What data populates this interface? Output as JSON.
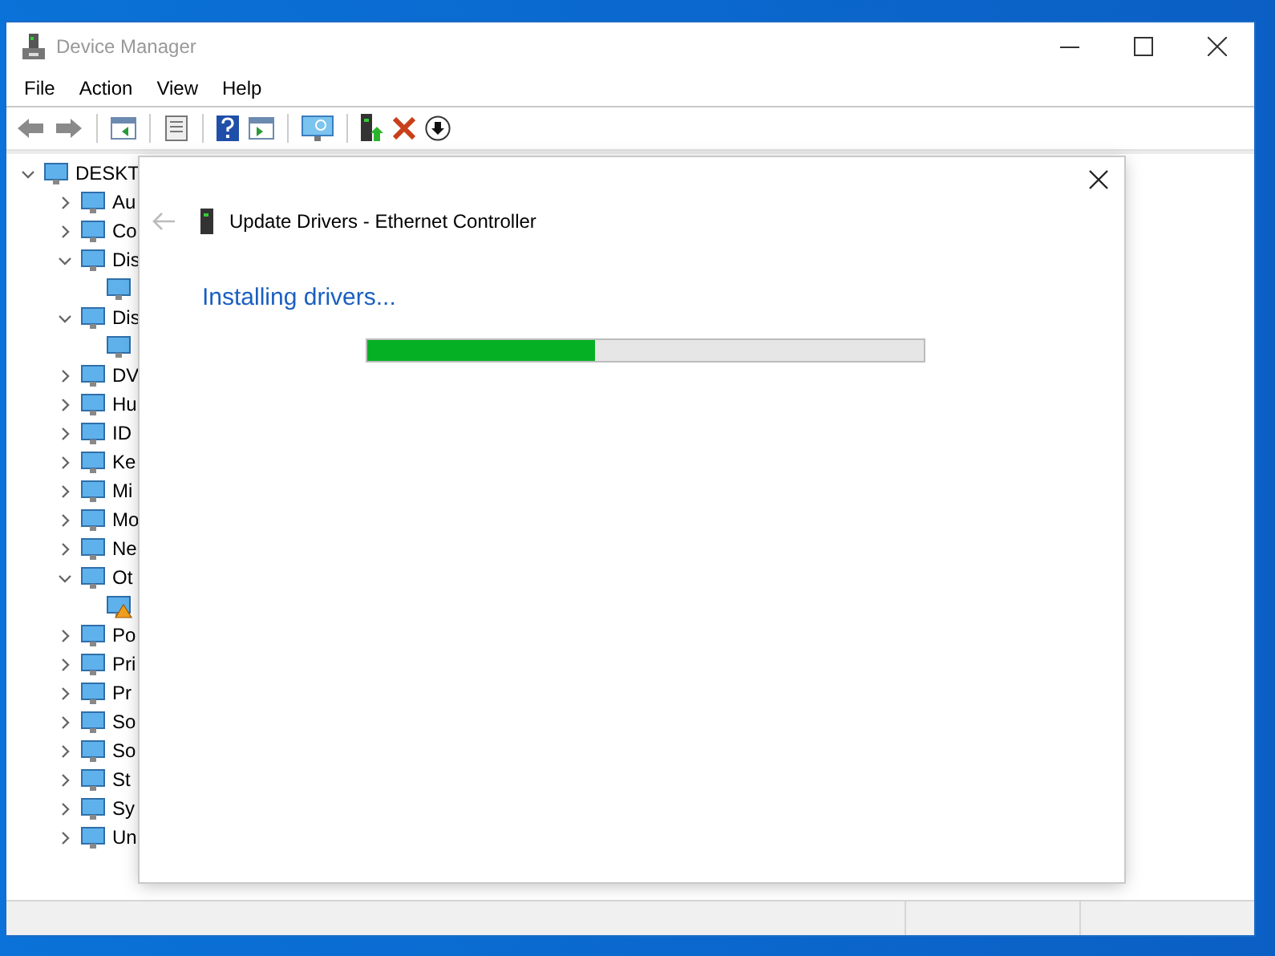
{
  "window": {
    "title": "Device Manager"
  },
  "menu": [
    "File",
    "Action",
    "View",
    "Help"
  ],
  "toolbar": [
    {
      "kind": "back",
      "disabled": false
    },
    {
      "kind": "forward",
      "disabled": false
    },
    {
      "kind": "sep"
    },
    {
      "kind": "pane"
    },
    {
      "kind": "sep"
    },
    {
      "kind": "props"
    },
    {
      "kind": "sep"
    },
    {
      "kind": "help"
    },
    {
      "kind": "pane2"
    },
    {
      "kind": "sep"
    },
    {
      "kind": "scan"
    },
    {
      "kind": "sep"
    },
    {
      "kind": "update"
    },
    {
      "kind": "uninstall"
    },
    {
      "kind": "disable"
    }
  ],
  "tree": {
    "label": "DESKT",
    "expanded": true,
    "children": [
      {
        "label": "Au",
        "expanded": false
      },
      {
        "label": "Co",
        "expanded": false
      },
      {
        "label": "Dis",
        "expanded": true,
        "children": [
          {
            "warning": false
          }
        ]
      },
      {
        "label": "Dis",
        "expanded": true,
        "children": [
          {
            "warning": false
          }
        ]
      },
      {
        "label": "DV",
        "expanded": false
      },
      {
        "label": "Hu",
        "expanded": false
      },
      {
        "label": "ID",
        "expanded": false
      },
      {
        "label": "Ke",
        "expanded": false
      },
      {
        "label": "Mi",
        "expanded": false
      },
      {
        "label": "Mo",
        "expanded": false
      },
      {
        "label": "Ne",
        "expanded": false
      },
      {
        "label": "Ot",
        "expanded": true,
        "children": [
          {
            "warning": true
          }
        ]
      },
      {
        "label": "Po",
        "expanded": false
      },
      {
        "label": "Pri",
        "expanded": false
      },
      {
        "label": "Pr",
        "expanded": false
      },
      {
        "label": "So",
        "expanded": false
      },
      {
        "label": "So",
        "expanded": false
      },
      {
        "label": "St",
        "expanded": false
      },
      {
        "label": "Sy",
        "expanded": false
      },
      {
        "label": "Un",
        "expanded": false
      }
    ]
  },
  "dialog": {
    "title": "Update Drivers - Ethernet Controller",
    "back_disabled": true,
    "heading": "Installing drivers...",
    "progress": {
      "level": 0.41
    }
  }
}
